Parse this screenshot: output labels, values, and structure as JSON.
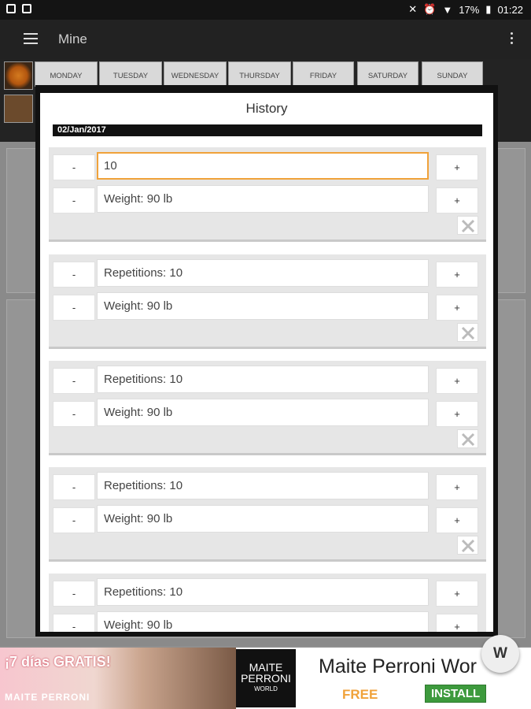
{
  "status": {
    "battery": "17%",
    "time": "01:22"
  },
  "appbar": {
    "title": "Mine"
  },
  "days": [
    "MONDAY",
    "TUESDAY",
    "WEDNESDAY",
    "THURSDAY",
    "FRIDAY",
    "SATURDAY",
    "SUNDAY"
  ],
  "dialog": {
    "title": "History",
    "date": "02/Jan/2017",
    "minus_label": "-",
    "plus_label": "+",
    "sets": [
      {
        "reps_value": "10",
        "weight": "Weight: 90 lb"
      },
      {
        "reps_value": "Repetitions: 10",
        "weight": "Weight: 90 lb"
      },
      {
        "reps_value": "Repetitions: 10",
        "weight": "Weight: 90 lb"
      },
      {
        "reps_value": "Repetitions: 10",
        "weight": "Weight: 90 lb"
      },
      {
        "reps_value": "Repetitions: 10",
        "weight": "Weight: 90 lb"
      }
    ]
  },
  "ad": {
    "promo": "¡7 días GRATIS!",
    "brand_left": "MAITE PERRONI",
    "logo_line1": "MAITE",
    "logo_line2": "PERRONI",
    "logo_line3": "WORLD",
    "title": "Maite Perroni Wor",
    "free": "FREE",
    "install": "INSTALL"
  },
  "fab": {
    "label": "W"
  }
}
